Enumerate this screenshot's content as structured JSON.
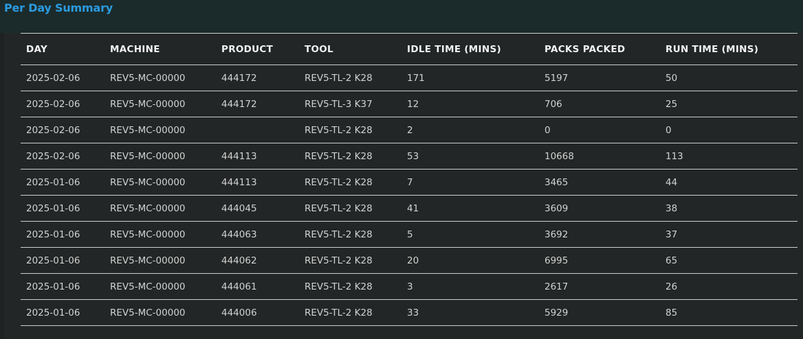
{
  "page": {
    "title": "Per Day Summary"
  },
  "table": {
    "headers": [
      "DAY",
      "MACHINE",
      "PRODUCT",
      "TOOL",
      "IDLE TIME (MINS)",
      "PACKS PACKED",
      "RUN TIME (MINS)"
    ],
    "rows": [
      [
        "2025-02-06",
        "REV5-MC-00000",
        "444172",
        "REV5-TL-2 K28",
        "171",
        "5197",
        "50"
      ],
      [
        "2025-02-06",
        "REV5-MC-00000",
        "444172",
        "REV5-TL-3 K37",
        "12",
        "706",
        "25"
      ],
      [
        "2025-02-06",
        "REV5-MC-00000",
        "",
        "REV5-TL-2 K28",
        "2",
        "0",
        "0"
      ],
      [
        "2025-02-06",
        "REV5-MC-00000",
        "444113",
        "REV5-TL-2 K28",
        "53",
        "10668",
        "113"
      ],
      [
        "2025-01-06",
        "REV5-MC-00000",
        "444113",
        "REV5-TL-2 K28",
        "7",
        "3465",
        "44"
      ],
      [
        "2025-01-06",
        "REV5-MC-00000",
        "444045",
        "REV5-TL-2 K28",
        "41",
        "3609",
        "38"
      ],
      [
        "2025-01-06",
        "REV5-MC-00000",
        "444063",
        "REV5-TL-2 K28",
        "5",
        "3692",
        "37"
      ],
      [
        "2025-01-06",
        "REV5-MC-00000",
        "444062",
        "REV5-TL-2 K28",
        "20",
        "6995",
        "65"
      ],
      [
        "2025-01-06",
        "REV5-MC-00000",
        "444061",
        "REV5-TL-2 K28",
        "3",
        "2617",
        "26"
      ],
      [
        "2025-01-06",
        "REV5-MC-00000",
        "444006",
        "REV5-TL-2 K28",
        "33",
        "5929",
        "85"
      ]
    ]
  },
  "colors": {
    "page_background": "#1b2b2b",
    "panel_background": "#232626",
    "title": "#2b9be0",
    "header_text": "#f2f2f2",
    "cell_text": "#d2d2d2",
    "row_divider": "#cfcfcf"
  }
}
